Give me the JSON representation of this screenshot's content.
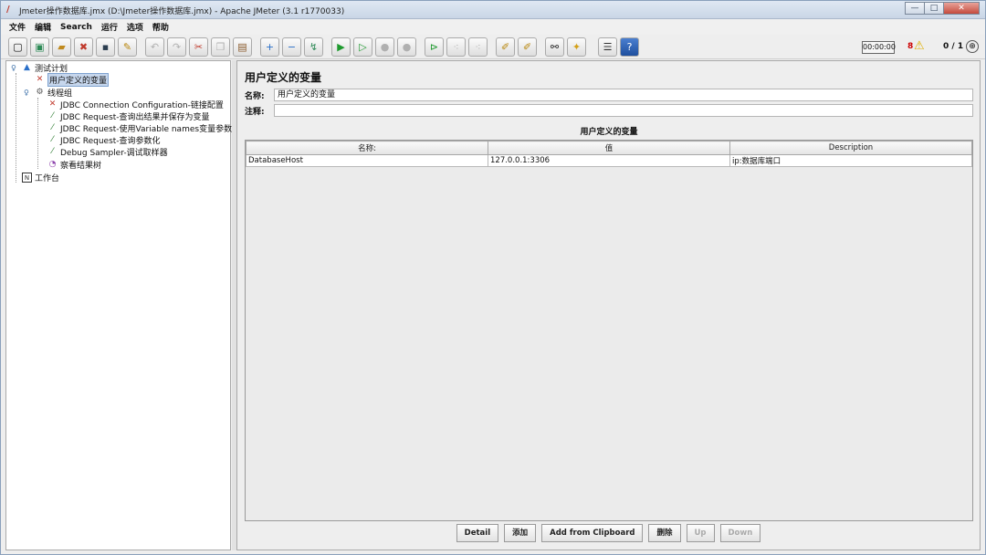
{
  "window": {
    "title": "Jmeter操作数据库.jmx (D:\\Jmeter操作数据库.jmx) - Apache JMeter (3.1 r1770033)"
  },
  "menu": [
    "文件",
    "编辑",
    "Search",
    "运行",
    "选项",
    "帮助"
  ],
  "toolbar": {
    "timer": "00:00:00",
    "error_count": "8",
    "threads": "0 / 1"
  },
  "tree": {
    "test_plan": "测试计划",
    "user_vars": "用户定义的变量",
    "thread_group": "线程组",
    "jdbc_config": "JDBC Connection Configuration-链接配置",
    "jdbc_req_1": "JDBC Request-查询出结果并保存为变量",
    "jdbc_req_2": "JDBC Request-使用Variable names变量参数",
    "jdbc_req_3": "JDBC Request-查询参数化",
    "debug_sampler": "Debug Sampler-调试取样器",
    "result_tree": "察看结果树",
    "workbench": "工作台"
  },
  "panel": {
    "title": "用户定义的变量",
    "name_label": "名称:",
    "name_value": "用户定义的变量",
    "comment_label": "注释:",
    "comment_value": "",
    "table_title": "用户定义的变量",
    "columns": [
      "名称:",
      "值",
      "Description"
    ],
    "rows": [
      [
        "DatabaseHost",
        "127.0.0.1:3306",
        "ip:数据库端口"
      ]
    ]
  },
  "buttons": {
    "detail": "Detail",
    "add": "添加",
    "add_clipboard": "Add from Clipboard",
    "delete": "删除",
    "up": "Up",
    "down": "Down"
  }
}
